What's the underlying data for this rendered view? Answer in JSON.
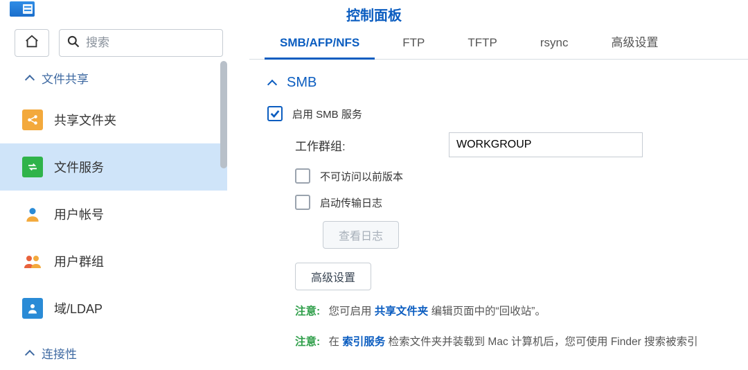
{
  "window": {
    "title": "控制面板"
  },
  "toolbar": {
    "search_placeholder": "搜索"
  },
  "sidebar": {
    "section1": "文件共享",
    "items": [
      {
        "label": "共享文件夹"
      },
      {
        "label": "文件服务"
      },
      {
        "label": "用户帐号"
      },
      {
        "label": "用户群组"
      },
      {
        "label": "域/LDAP"
      }
    ],
    "section2": "连接性"
  },
  "tabs": [
    {
      "label": "SMB/AFP/NFS"
    },
    {
      "label": "FTP"
    },
    {
      "label": "TFTP"
    },
    {
      "label": "rsync"
    },
    {
      "label": "高级设置"
    }
  ],
  "smb": {
    "header": "SMB",
    "enable": "启用 SMB 服务",
    "workgroup_label": "工作群组:",
    "workgroup_value": "WORKGROUP",
    "disable_prev": "不可访问以前版本",
    "enable_log": "启动传输日志",
    "view_log_btn": "查看日志",
    "advanced_btn": "高级设置",
    "note_label": "注意:",
    "note1_before": "您可启用 ",
    "note1_link": "共享文件夹",
    "note1_after": " 编辑页面中的“回收站”。",
    "note2_before": "在 ",
    "note2_link": "索引服务",
    "note2_after": " 检索文件夹并装载到 Mac 计算机后，您可使用 Finder 搜索被索引"
  }
}
